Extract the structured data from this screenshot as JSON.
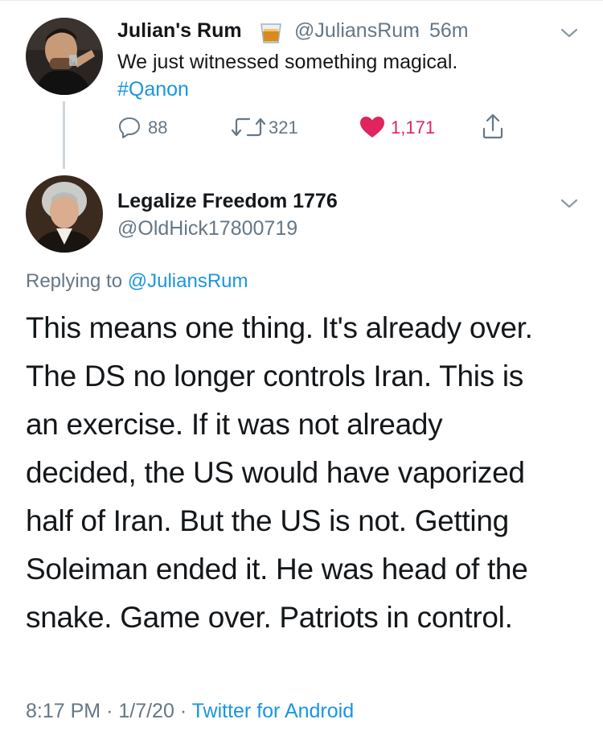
{
  "tweet1": {
    "display_name": "Julian's Rum",
    "name_emoji": "tumbler-glass-icon",
    "handle": "@JuliansRum",
    "separator": "·",
    "time": "56m",
    "text": "We just witnessed something magical.",
    "hashtag": "#Qanon",
    "replies": "88",
    "retweets": "321",
    "likes": "1,171",
    "liked": true
  },
  "tweet2": {
    "display_name": "Legalize Freedom 1776",
    "handle": "@OldHick17800719",
    "replying_prefix": "Replying to",
    "replying_to": "@JuliansRum",
    "lines": [
      "This means one thing. It's already over.",
      "The DS no longer controls Iran. This is",
      "an exercise. If it was not already",
      "decided, the US would have vaporized",
      "half of Iran. But the US is not. Getting",
      "Soleiman ended it. He was head of the",
      "snake. Game over. Patriots in control."
    ],
    "time": "8:17 PM",
    "date": "1/7/20",
    "separator": "·",
    "source": "Twitter for Android"
  },
  "colors": {
    "link": "#1b95e0",
    "muted": "#657786",
    "like": "#e0245e",
    "text": "#14171a"
  }
}
